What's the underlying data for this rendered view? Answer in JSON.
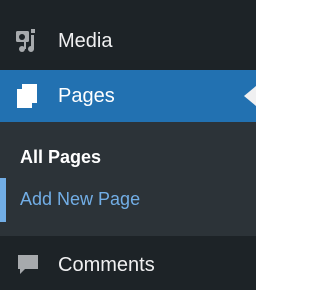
{
  "sidebar": {
    "items": [
      {
        "label": "Media",
        "icon": "media-icon"
      },
      {
        "label": "Pages",
        "icon": "pages-icon",
        "active": true
      },
      {
        "label": "Comments",
        "icon": "comments-icon"
      }
    ],
    "submenu": {
      "items": [
        {
          "label": "All Pages",
          "current": true
        },
        {
          "label": "Add New Page"
        }
      ]
    }
  },
  "colors": {
    "sidebar_bg": "#1d2327",
    "submenu_bg": "#2c3338",
    "active_bg": "#2271b1",
    "link_blue": "#72aee6",
    "text": "#f0f0f1",
    "icon_muted": "#a7aaad"
  }
}
